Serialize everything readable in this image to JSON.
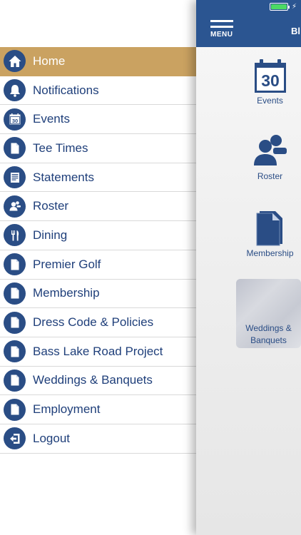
{
  "menu": {
    "items": [
      {
        "label": "Home",
        "icon": "home-icon"
      },
      {
        "label": "Notifications",
        "icon": "bell-icon"
      },
      {
        "label": "Events",
        "icon": "calendar-icon"
      },
      {
        "label": "Tee Times",
        "icon": "document-icon"
      },
      {
        "label": "Statements",
        "icon": "statement-icon"
      },
      {
        "label": "Roster",
        "icon": "people-icon"
      },
      {
        "label": "Dining",
        "icon": "fork-knife-icon"
      },
      {
        "label": "Premier Golf",
        "icon": "document-icon"
      },
      {
        "label": "Membership",
        "icon": "document-icon"
      },
      {
        "label": "Dress Code & Policies",
        "icon": "document-icon"
      },
      {
        "label": "Bass Lake Road Project",
        "icon": "document-icon"
      },
      {
        "label": "Weddings & Banquets",
        "icon": "document-icon"
      },
      {
        "label": "Employment",
        "icon": "document-icon"
      },
      {
        "label": "Logout",
        "icon": "logout-icon"
      }
    ],
    "active": "Home"
  },
  "header": {
    "menu_label": "MENU",
    "title_fragment": "Bl"
  },
  "tiles": {
    "events": {
      "label": "Events",
      "calendar_day": "30"
    },
    "roster": {
      "label": "Roster"
    },
    "membership": {
      "label": "Membership"
    },
    "weddings": {
      "label": "Weddings & Banquets"
    }
  },
  "colors": {
    "primary": "#2b5591",
    "icon_blue": "#2a4d85",
    "active_gold": "#caa261",
    "battery_green": "#4cd964"
  }
}
